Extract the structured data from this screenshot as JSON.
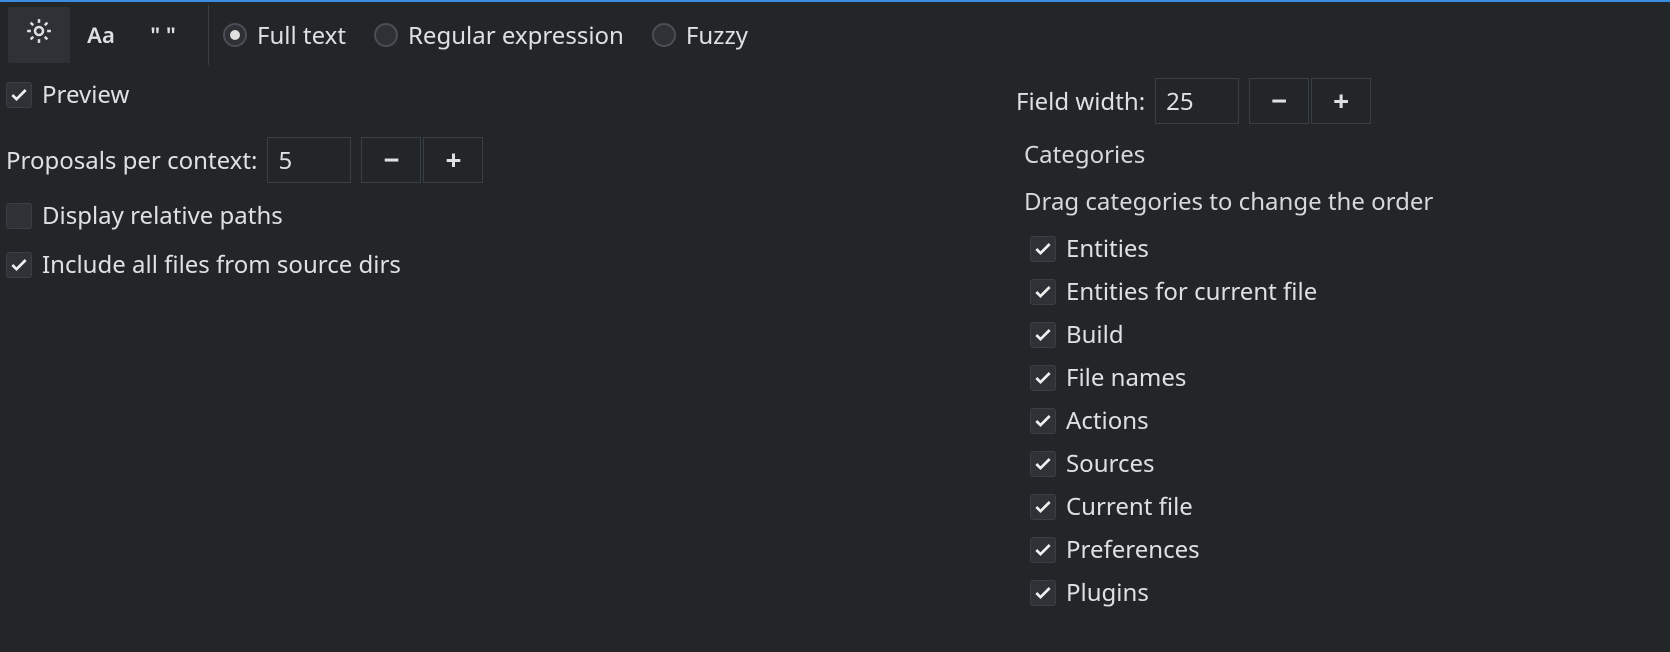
{
  "toolbar": {
    "tabs": {
      "gear": "gear",
      "aa": "Aa",
      "quotes": "\" \""
    },
    "radios": {
      "fulltext": "Full text",
      "regex": "Regular expression",
      "fuzzy": "Fuzzy",
      "selected": "fulltext"
    }
  },
  "left": {
    "preview": {
      "label": "Preview",
      "checked": true
    },
    "proposals": {
      "label": "Proposals per context:",
      "value": "5"
    },
    "relative_paths": {
      "label": "Display relative paths",
      "checked": false
    },
    "include_all": {
      "label": "Include all files from source dirs",
      "checked": true
    }
  },
  "right": {
    "field_width": {
      "label": "Field width:",
      "value": "25"
    },
    "categories_title": "Categories",
    "categories_hint": "Drag categories to change the order",
    "categories": [
      {
        "label": "Entities",
        "checked": true
      },
      {
        "label": "Entities for current file",
        "checked": true
      },
      {
        "label": "Build",
        "checked": true
      },
      {
        "label": "File names",
        "checked": true
      },
      {
        "label": "Actions",
        "checked": true
      },
      {
        "label": "Sources",
        "checked": true
      },
      {
        "label": "Current file",
        "checked": true
      },
      {
        "label": "Preferences",
        "checked": true
      },
      {
        "label": "Plugins",
        "checked": true
      }
    ]
  },
  "glyphs": {
    "minus": "−",
    "plus": "+"
  }
}
